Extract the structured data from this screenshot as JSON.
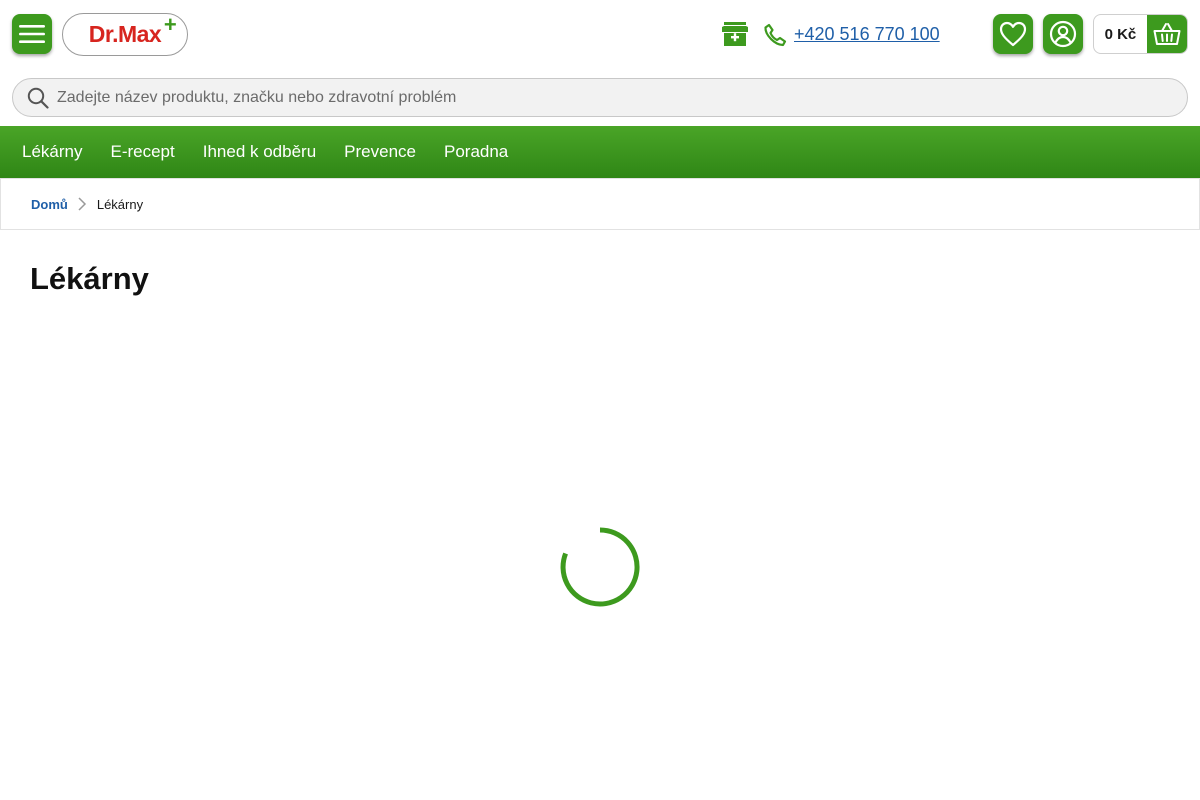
{
  "header": {
    "logo_text": "Dr.Max",
    "logo_plus": "+",
    "phone": "+420 516 770 100",
    "cart_total": "0 Kč",
    "icons": {
      "menu": "hamburger-menu-icon",
      "store": "store-pharmacy-icon",
      "phone": "phone-icon",
      "favorites": "heart-icon",
      "account": "user-account-icon",
      "cart": "basket-icon"
    }
  },
  "search": {
    "placeholder": "Zadejte název produktu, značku nebo zdravotní problém",
    "value": ""
  },
  "nav": {
    "items": [
      {
        "label": "Lékárny"
      },
      {
        "label": "E-recept"
      },
      {
        "label": "Ihned k odběru"
      },
      {
        "label": "Prevence"
      },
      {
        "label": "Poradna"
      }
    ]
  },
  "breadcrumb": {
    "home": "Domů",
    "current": "Lékárny"
  },
  "main": {
    "title": "Lékárny",
    "loading": true
  },
  "colors": {
    "brand_green": "#3d9a1e",
    "brand_red": "#d7251f",
    "link_blue": "#1f5fa8"
  }
}
